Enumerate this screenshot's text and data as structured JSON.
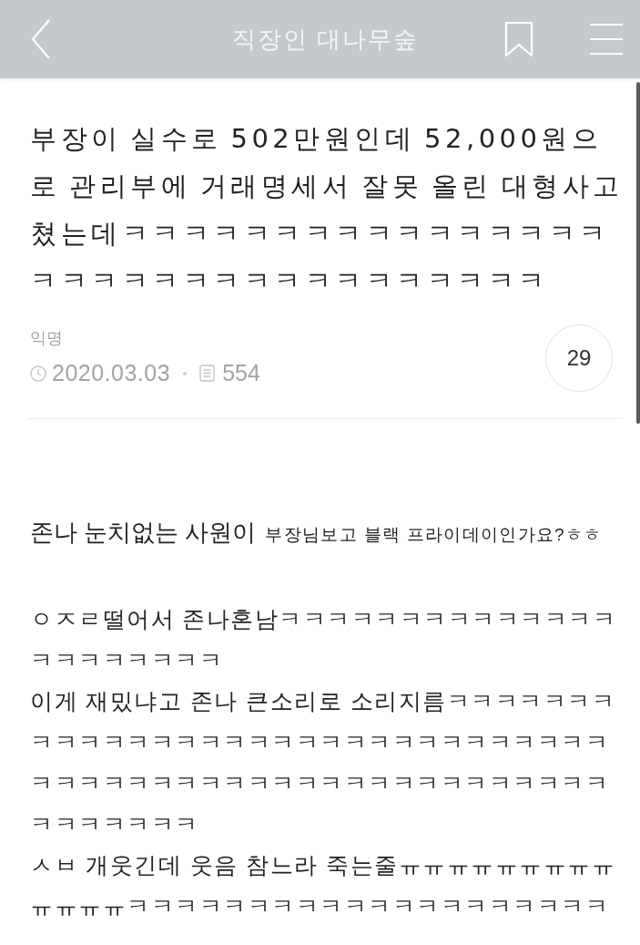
{
  "header": {
    "title": "직장인 대나무숲"
  },
  "post": {
    "title": "부장이 실수로 502만원인데 52,000원으로 관리부에 거래명세서 잘못 올린 대형사고 쳤는데ㅋㅋㅋㅋㅋㅋㅋㅋㅋㅋㅋㅋㅋㅋㅋㅋㅋㅋㅋㅋㅋㅋㅋㅋㅋㅋㅋㅋㅋㅋㅋㅋㅋ",
    "author": "익명",
    "date": "2020.03.03",
    "views": "554",
    "comments": "29"
  },
  "body": {
    "lead": [
      {
        "text": "존나 눈치없는 사원이",
        "kind": "large"
      },
      {
        "text": "부장님보고 블랙 프라이데이인가요?ㅎㅎ",
        "kind": "small"
      }
    ],
    "paragraphs": [
      "ㅇㅈㄹ떨어서 존나혼남ㅋㅋㅋㅋㅋㅋㅋㅋㅋㅋㅋㅋㅋㅋㅋㅋㅋㅋㅋㅋㅋㅋ",
      "이게 재밌냐고 존나 큰소리로 소리지름ㅋㅋㅋㅋㅋㅋㅋㅋㅋㅋㅋㅋㅋㅋㅋㅋㅋㅋㅋㅋㅋㅋㅋㅋㅋㅋㅋㅋㅋㅋㅋㅋㅋㅋㅋㅋㅋㅋㅋㅋㅋㅋㅋㅋㅋㅋㅋㅋㅋㅋㅋㅋㅋㅋㅋㅋㅋㅋㅋㅋㅋㅋ",
      "ㅅㅂ 개웃긴데 웃음 참느라 죽는줄ㅠㅠㅠㅠㅠㅠㅠㅠㅠㅠㅠㅠㅠㅋㅋㅋㅋㅋㅋㅋㅋㅋㅋㅋㅋㅋㅋㅋㅋㅋㅋㅋㅋ"
    ]
  }
}
